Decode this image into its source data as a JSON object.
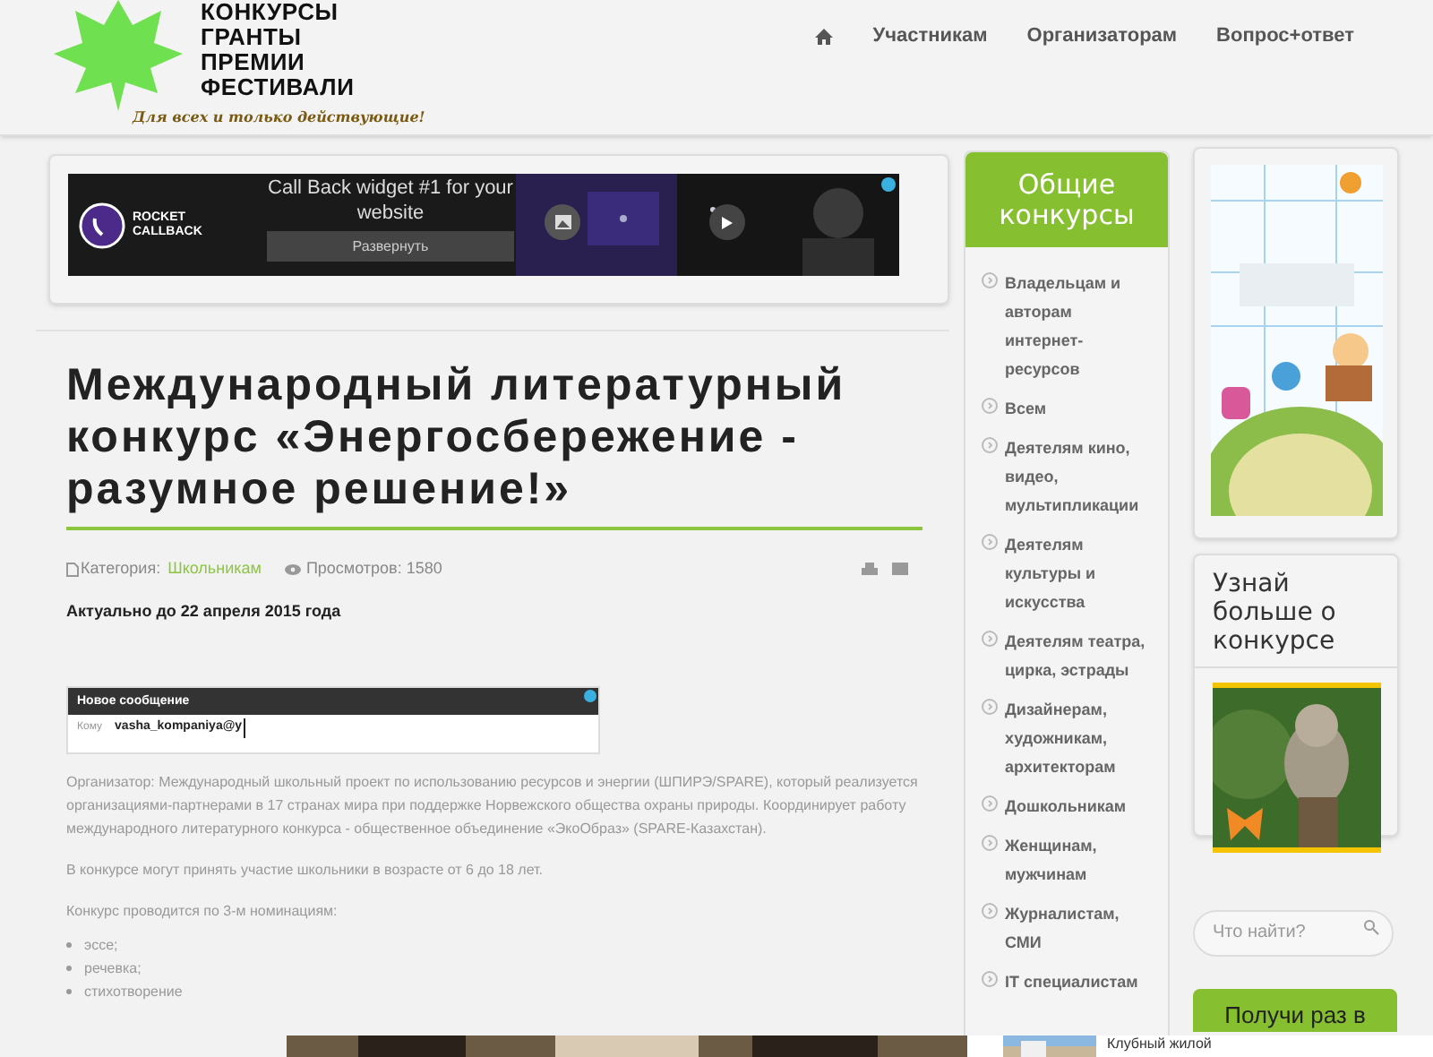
{
  "logo": {
    "lines": [
      "КОНКУРСЫ",
      "ГРАНТЫ",
      "ПРЕМИИ",
      "ФЕСТИВАЛИ"
    ],
    "slogan": "Для всех и только действующие!"
  },
  "nav": {
    "items": [
      {
        "kind": "home"
      },
      {
        "kind": "link",
        "label": "Участникам"
      },
      {
        "kind": "link",
        "label": "Организаторам"
      },
      {
        "kind": "link",
        "label": "Вопрос+ответ"
      }
    ]
  },
  "top_ad": {
    "brand": [
      "ROCKET",
      "CALLBACK"
    ],
    "headline": "Call Back widget #1 for your website",
    "button": "Развернуть"
  },
  "article": {
    "title": "Международный литературный конкурс «Энергосбережение - разумное решение!»",
    "category_label": "Категория:",
    "category": "Школьникам",
    "views": "Просмотров: 1580",
    "deadline": "Актуально до 22 апреля 2015 года",
    "mail_ad": {
      "title": "Новое сообщение",
      "to_label": "Кому",
      "to_value": "vasha_kompaniya@y"
    },
    "paragraphs": [
      "Организатор: Международный школьный проект по использованию ресурсов и энергии (ШПИРЭ/SPARE), который реализуется организациями-партнерами в 17 странах мира при поддержке Норвежского общества охраны природы. Координирует работу международного литературного конкурса - общественное объединение «ЭкоОбраз» (SPARE-Казахстан).",
      "В конкурсе могут принять участие школьники в возрасте от 6 до 18 лет.",
      "Конкурс проводится по 3-м номинациям:"
    ],
    "list": [
      "эссе;",
      "речевка;",
      "стихотворение"
    ]
  },
  "categories": {
    "title": "Общие конкурсы",
    "items": [
      "Владельцам и авторам интернет-ресурсов",
      "Всем",
      "Деятелям кино, видео, мультипликации",
      "Деятелям культуры и искусства",
      "Деятелям театра, цирка, эстрады",
      "Дизайнерам, художникам, архитекторам",
      "Дошкольникам",
      "Женщинам, мужчинам",
      "Журналистам, СМИ",
      "IT специалистам"
    ]
  },
  "learn_more": {
    "title": "Узнай больше о конкурсе"
  },
  "search": {
    "placeholder": "Что найти?"
  },
  "cta": {
    "label": "Получи раз в"
  },
  "bottom_ad": {
    "text": "Клубный жилой"
  }
}
